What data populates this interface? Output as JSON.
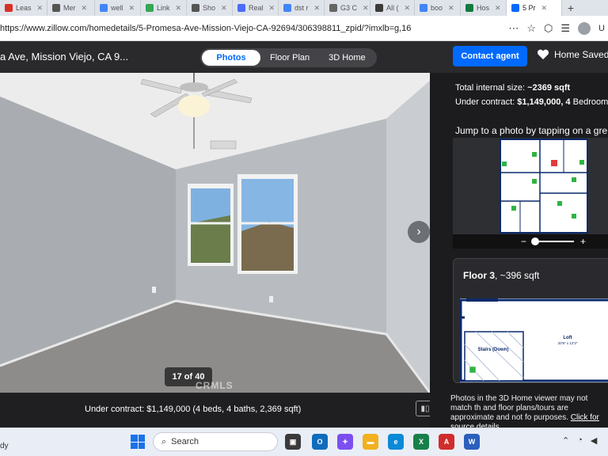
{
  "browser": {
    "tabs": [
      {
        "label": "Leas",
        "color": "#d93025",
        "icon": "pdf-icon"
      },
      {
        "label": "Mer",
        "color": "#555555",
        "icon": "b-icon"
      },
      {
        "label": "well",
        "color": "#4285f4",
        "icon": "search-icon"
      },
      {
        "label": "Link",
        "color": "#34a853",
        "icon": "arrow-icon"
      },
      {
        "label": "Sho",
        "color": "#555555",
        "icon": "b-icon"
      },
      {
        "label": "Real",
        "color": "#4a6cf7",
        "icon": "zillow-icon"
      },
      {
        "label": "dst r",
        "color": "#4285f4",
        "icon": "search-icon"
      },
      {
        "label": "G3 C",
        "color": "#666666",
        "icon": "square-icon"
      },
      {
        "label": "All (",
        "color": "#3b3b3b",
        "icon": "aw-icon"
      },
      {
        "label": "boo",
        "color": "#4285f4",
        "icon": "search-icon"
      },
      {
        "label": "Hos",
        "color": "#0f7b3f",
        "icon": "excel-icon"
      },
      {
        "label": "5 Pr",
        "color": "#006aff",
        "icon": "zillow-icon",
        "active": true
      }
    ],
    "url": "https://www.zillow.com/homedetails/5-Promesa-Ave-Mission-Viejo-CA-92694/306398811_zpid/?imxlb=g,16"
  },
  "header": {
    "title": "a Ave, Mission Viejo, CA 9...",
    "segments": [
      "Photos",
      "Floor Plan",
      "3D Home"
    ],
    "selected_segment": "Photos",
    "contact_label": "Contact agent",
    "saved_label": "Home Saved"
  },
  "photo": {
    "counter": "17 of 40",
    "watermark": "CRMLS",
    "caption": "Under contract: $1,149,000 (4 beds, 4 baths, 2,369 sqft)"
  },
  "side": {
    "size_prefix": "Total internal size: ",
    "size_value": "~2369 sqft",
    "contract_prefix": "Under contract: ",
    "contract_value": "$1,149,000, 4",
    "contract_suffix": " Bedrooms",
    "jump_text": "Jump to a photo by tapping on a gre",
    "floor_name": "Floor 3",
    "floor_size": ", ~396 sqft",
    "room_loft": "Loft",
    "room_loft_dim": "20'8\" x 12'3\"",
    "room_stairs": "Stairs (Down)",
    "disclaimer": "Photos in the 3D Home viewer may not match th and floor plans/tours are approximate and not fo purposes. ",
    "source_link": "Click for source details."
  },
  "taskbar": {
    "status_text": "dy",
    "search_label": "Search"
  }
}
